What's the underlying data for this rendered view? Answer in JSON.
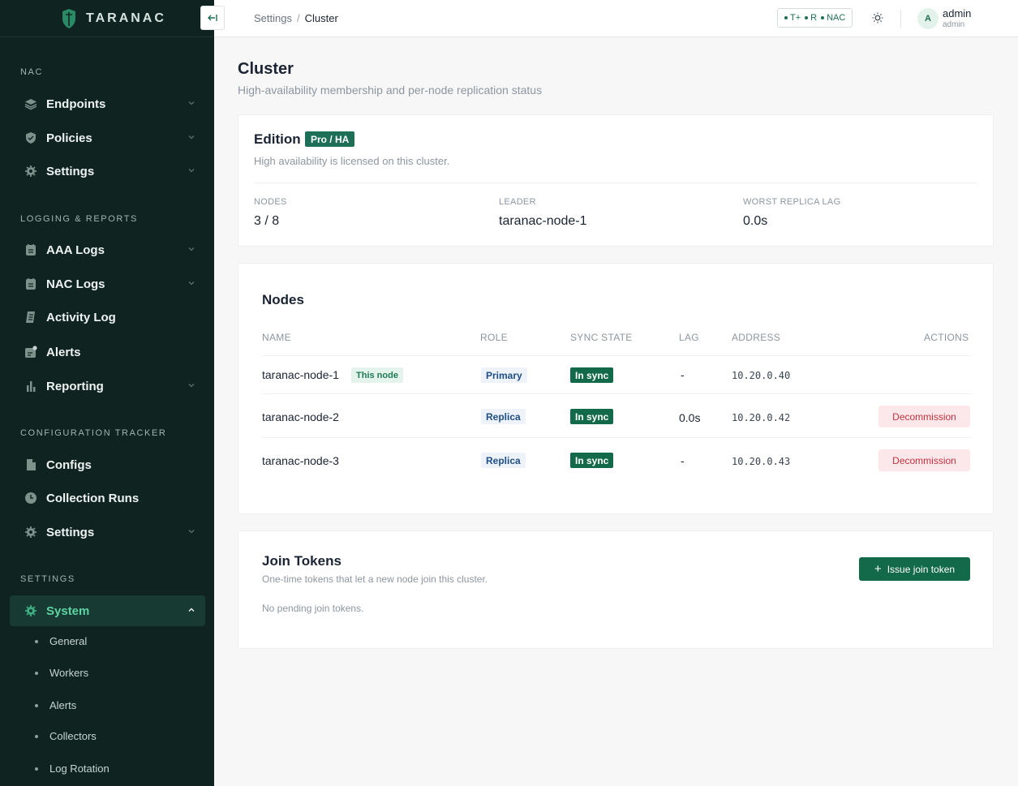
{
  "app": {
    "brand": "TARANAC"
  },
  "sidebar": {
    "sections": [
      {
        "label": "NAC"
      },
      {
        "label": "LOGGING & REPORTS"
      },
      {
        "label": "CONFIGURATION TRACKER"
      },
      {
        "label": "SETTINGS"
      }
    ],
    "items": [
      {
        "label": "Endpoints",
        "icon": "layers-icon"
      },
      {
        "label": "Policies",
        "icon": "shield-check-icon"
      },
      {
        "label": "Settings",
        "icon": "gear-icon"
      },
      {
        "label": "AAA Logs",
        "icon": "log-book-icon"
      },
      {
        "label": "NAC Logs",
        "icon": "log-book-icon"
      },
      {
        "label": "Activity Log",
        "icon": "scroll-icon"
      },
      {
        "label": "Alerts",
        "icon": "alert-box-icon"
      },
      {
        "label": "Reporting",
        "icon": "bar-chart-icon"
      },
      {
        "label": "Configs",
        "icon": "document-icon"
      },
      {
        "label": "Collection Runs",
        "icon": "clock-icon"
      },
      {
        "label": "Settings",
        "icon": "gear-icon"
      },
      {
        "label": "System",
        "icon": "gear-icon"
      }
    ],
    "system_sub": [
      "General",
      "Workers",
      "Alerts",
      "Collectors",
      "Log Rotation"
    ]
  },
  "topbar": {
    "breadcrumb": {
      "parent": "Settings",
      "separator": "/",
      "current": "Cluster"
    },
    "protocols": [
      "T+",
      "R",
      "NAC"
    ],
    "user": {
      "initial": "A",
      "name": "admin",
      "role": "admin"
    }
  },
  "page": {
    "title": "Cluster",
    "subtitle": "High-availability membership and per-node replication status"
  },
  "edition": {
    "title": "Edition",
    "badge": "Pro / HA",
    "description": "High availability is licensed on this cluster.",
    "stats": [
      {
        "label": "NODES",
        "value": "3 / 8"
      },
      {
        "label": "LEADER",
        "value": "taranac-node-1"
      },
      {
        "label": "WORST REPLICA LAG",
        "value": "0.0s"
      }
    ]
  },
  "nodes": {
    "title": "Nodes",
    "columns": [
      "NAME",
      "ROLE",
      "SYNC STATE",
      "LAG",
      "ADDRESS",
      "ACTIONS"
    ],
    "rows": [
      {
        "name": "taranac-node-1",
        "tag": "This node",
        "role": "Primary",
        "sync": "In sync",
        "lag": "-",
        "address": "10.20.0.40",
        "action": ""
      },
      {
        "name": "taranac-node-2",
        "tag": "",
        "role": "Replica",
        "sync": "In sync",
        "lag": "0.0s",
        "address": "10.20.0.42",
        "action": "Decommission"
      },
      {
        "name": "taranac-node-3",
        "tag": "",
        "role": "Replica",
        "sync": "In sync",
        "lag": "-",
        "address": "10.20.0.43",
        "action": "Decommission"
      }
    ]
  },
  "join_tokens": {
    "title": "Join Tokens",
    "description": "One-time tokens that let a new node join this cluster.",
    "empty": "No pending join tokens.",
    "button": "Issue join token"
  },
  "colors": {
    "sidebar_bg": "#0f2421",
    "accent": "#136a4a",
    "active_text": "#5fd3a4",
    "danger": "#c4323e"
  }
}
